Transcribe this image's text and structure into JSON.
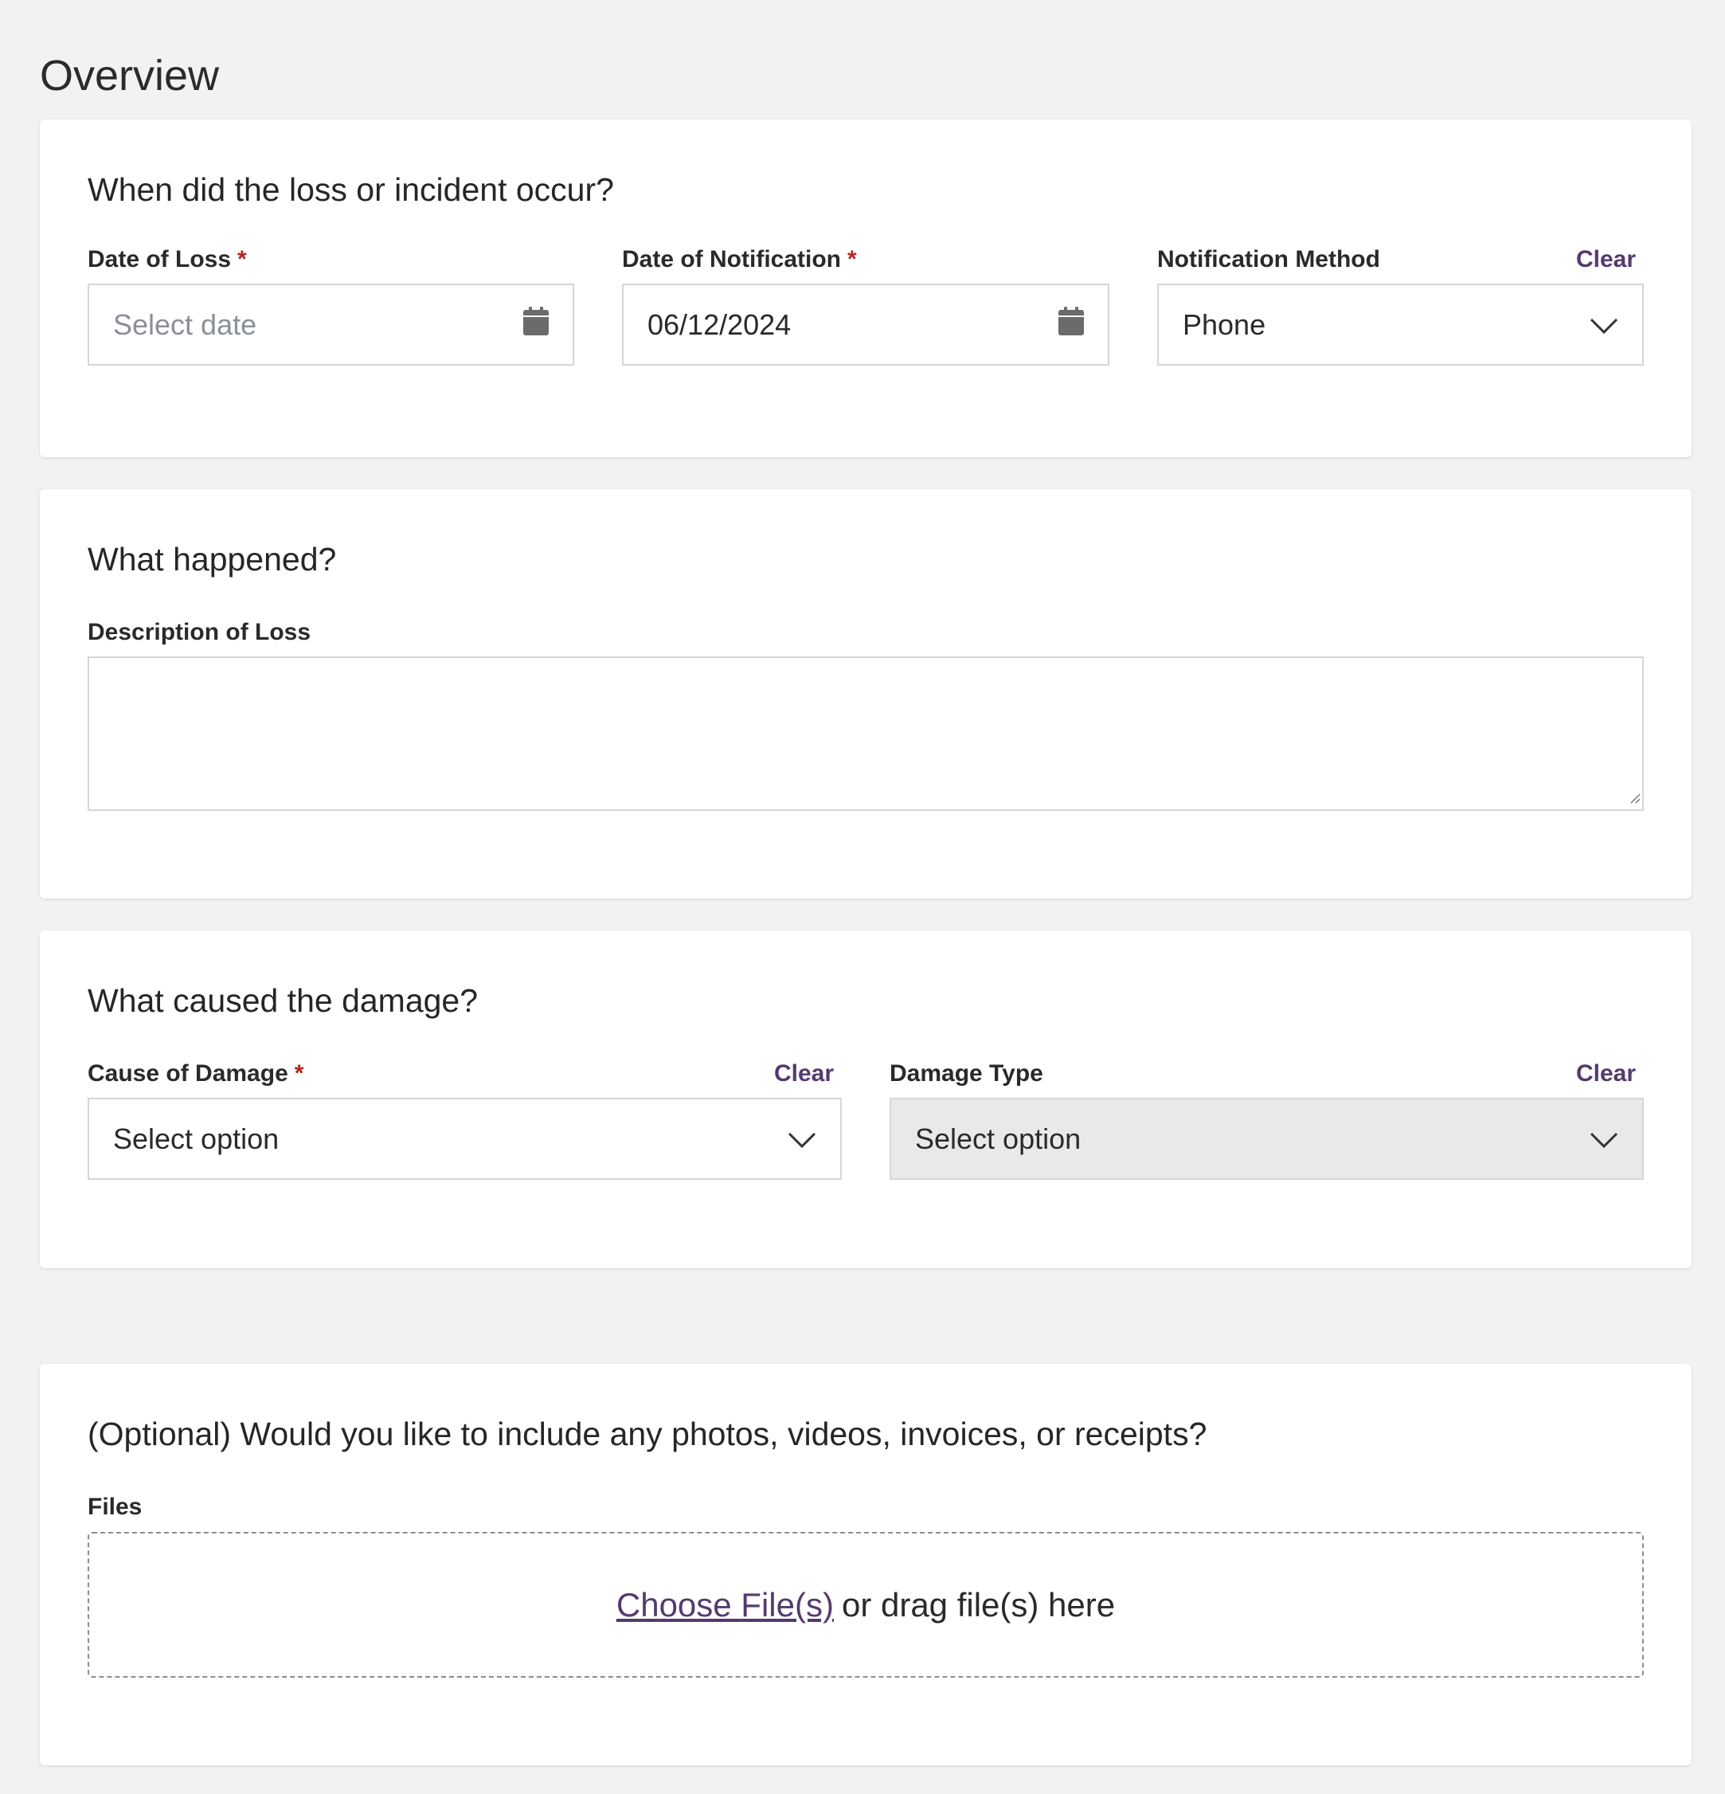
{
  "page": {
    "title": "Overview"
  },
  "sections": {
    "when": {
      "title": "When did the loss or incident occur?",
      "date_of_loss": {
        "label": "Date of Loss",
        "required_mark": "*",
        "placeholder": "Select date",
        "value": "",
        "icon": "calendar-icon"
      },
      "date_of_notification": {
        "label": "Date of Notification",
        "required_mark": "*",
        "value": "06/12/2024",
        "icon": "calendar-icon"
      },
      "notification_method": {
        "label": "Notification Method",
        "clear_label": "Clear",
        "value": "Phone",
        "icon": "chevron-down-icon"
      }
    },
    "what_happened": {
      "title": "What happened?",
      "description": {
        "label": "Description of Loss",
        "value": ""
      }
    },
    "damage": {
      "title": "What caused the damage?",
      "cause": {
        "label": "Cause of Damage",
        "required_mark": "*",
        "clear_label": "Clear",
        "value": "Select option",
        "icon": "chevron-down-icon"
      },
      "type": {
        "label": "Damage Type",
        "clear_label": "Clear",
        "value": "Select option",
        "disabled": true,
        "icon": "chevron-down-icon"
      }
    },
    "files": {
      "title": "(Optional) Would you like to include any photos, videos, invoices, or receipts?",
      "label": "Files",
      "choose_label": "Choose File(s)",
      "drag_text": "or drag file(s) here"
    }
  },
  "colors": {
    "background": "#f1f2f4",
    "card": "#ffffff",
    "accent": "#553a6e",
    "required": "#b3261e",
    "disabled_field": "#e8e9eb"
  }
}
